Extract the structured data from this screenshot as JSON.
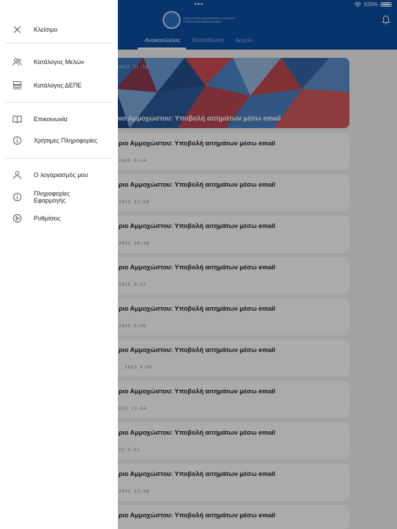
{
  "status": {
    "dots": "•••",
    "battery": "100%"
  },
  "header": {
    "logo_text": "ΠΑΓΚΥΠΡΙΟΣ ΔΙΚΗΓΟΡΙΚΟΣ ΣΥΛΛΟΓΟΣ CYPRUS BAR ASSOCIATION",
    "tabs": [
      {
        "label": "Ανακοινώσεις",
        "active": true
      },
      {
        "label": "Εκπαίδευση",
        "active": false
      },
      {
        "label": "Αρχείο",
        "active": false
      }
    ]
  },
  "feed": {
    "hero": {
      "date": "2023 11:56",
      "title": "ριο Αμμοχώστου: Υποβολή αιτημάτων μέσω email"
    },
    "items": [
      {
        "title": "ριο Αμμοχώστου: Υποβολή αιτημάτων μέσω email",
        "date": "2023 6:14"
      },
      {
        "title": "ριο Αμμοχώστου: Υποβολή αιτημάτων μέσω email",
        "date": "2023 11:50"
      },
      {
        "title": "ριο Αμμοχώστου: Υποβολή αιτημάτων μέσω email",
        "date": "2023 16:16"
      },
      {
        "title": "ριο Αμμοχώστου: Υποβολή αιτημάτων μέσω email",
        "date": "2023 9:13"
      },
      {
        "title": "ριο Αμμοχώστου: Υποβολή αιτημάτων μέσω email",
        "date": "2023 5:36"
      },
      {
        "title": "ριο Αμμοχώστου: Υποβολή αιτημάτων μέσω email",
        "date": ". 2023 6:05"
      },
      {
        "title": "ριο Αμμοχώστου: Υποβολή αιτημάτων μέσω email",
        "date": "023 13:04"
      },
      {
        "title": "ριο Αμμοχώστου: Υποβολή αιτημάτων μέσω email",
        "date": "23 5:31"
      },
      {
        "title": "ριο Αμμοχώστου: Υποβολή αιτημάτων μέσω email",
        "date": "2023 13:26"
      },
      {
        "title": "ριο Αμμοχώστου: Υποβολή αιτημάτων μέσω email",
        "date": ""
      }
    ]
  },
  "drawer": {
    "close": {
      "label": "Κλείσιμο",
      "icon": "close-icon"
    },
    "items": [
      {
        "label": "Κατάλογος Μελών",
        "icon": "members-icon"
      },
      {
        "label": "Κατάλογος ΔΕΠΕ",
        "icon": "server-list-icon"
      },
      {
        "label": "Επικοινωνία",
        "icon": "book-icon"
      },
      {
        "label": "Χρήσιμες Πληροφορίες",
        "icon": "info-icon"
      },
      {
        "label": "Ο λογαριασμός μου",
        "icon": "user-icon"
      },
      {
        "label": "Πληροφορίες Εφαρμογής",
        "icon": "info-icon"
      },
      {
        "label": "Ρυθμίσεις",
        "icon": "settings-icon"
      }
    ]
  },
  "colors": {
    "header": "#0d4ea3",
    "overlay": "rgba(0,0,0,0.33)"
  }
}
